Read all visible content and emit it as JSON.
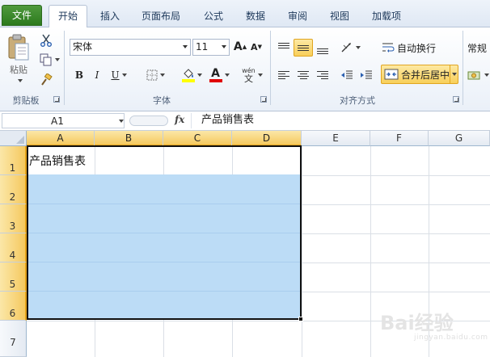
{
  "tabs": [
    {
      "label": "文件",
      "kind": "file"
    },
    {
      "label": "开始",
      "kind": "active"
    },
    {
      "label": "插入",
      "kind": ""
    },
    {
      "label": "页面布局",
      "kind": ""
    },
    {
      "label": "公式",
      "kind": ""
    },
    {
      "label": "数据",
      "kind": ""
    },
    {
      "label": "审阅",
      "kind": ""
    },
    {
      "label": "视图",
      "kind": ""
    },
    {
      "label": "加载项",
      "kind": ""
    }
  ],
  "clipboard": {
    "paste_label": "粘贴",
    "group_label": "剪贴板"
  },
  "font": {
    "font_name": "宋体",
    "font_size": "11",
    "grow_label": "A",
    "shrink_label": "A",
    "bold_label": "B",
    "italic_label": "I",
    "underline_label": "U",
    "font_color_label": "A",
    "phonetic_label": "wén",
    "phonetic_char": "文",
    "group_label": "字体"
  },
  "alignment": {
    "wrap_label": "自动换行",
    "merge_label": "合并后居中",
    "group_label": "对齐方式"
  },
  "number": {
    "format_value": "常规"
  },
  "formula_bar": {
    "name_box": "A1",
    "fx_label": "fx",
    "content": "产品销售表"
  },
  "grid": {
    "columns": [
      "A",
      "B",
      "C",
      "D",
      "E",
      "F",
      "G"
    ],
    "rows": [
      "1",
      "2",
      "3",
      "4",
      "5",
      "6",
      "7"
    ],
    "selected_range": "A1:D6",
    "cell_a1": "产品销售表"
  },
  "watermark": {
    "text": "Bai经验",
    "sub": "jingyan.baidu.com"
  },
  "colors": {
    "selection_fill": "#bcdcf6",
    "header_highlight": "#f5c95f",
    "file_tab": "#2c7a1d",
    "font_color_bar": "#e00000",
    "fill_color_bar": "#ffff00"
  }
}
